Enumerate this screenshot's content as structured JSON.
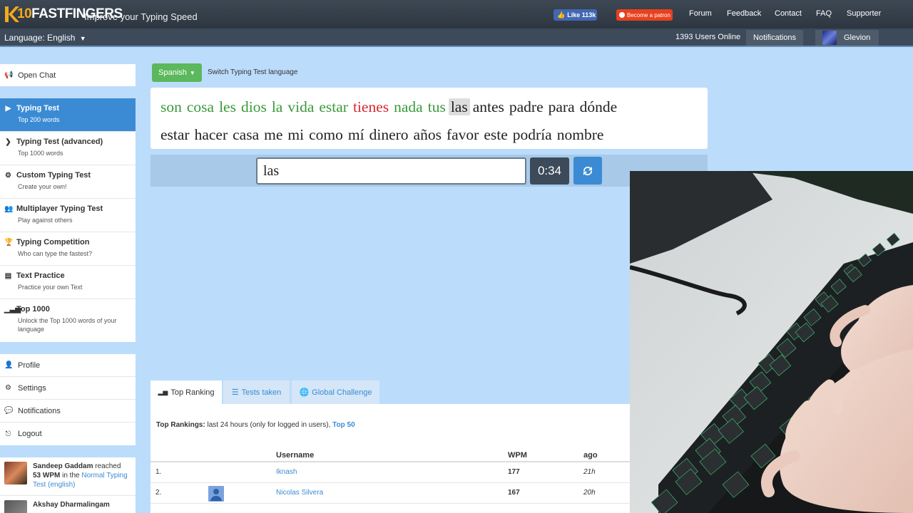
{
  "header": {
    "logo_prefix": "10",
    "logo_text": "FASTFINGERS",
    "tagline": "Improve your Typing Speed",
    "fb_like": "Like 113k",
    "patron": "Become a patron",
    "nav": [
      "Forum",
      "Feedback",
      "Contact",
      "FAQ",
      "Supporter"
    ]
  },
  "subbar": {
    "language": "Language: English",
    "users_online": "1393 Users Online",
    "notifications": "Notifications",
    "username": "Glevion"
  },
  "sidebar": {
    "open_chat": "Open Chat",
    "menu": [
      {
        "title": "Typing Test",
        "sub": "Top 200 words",
        "icon": "play-icon"
      },
      {
        "title": "Typing Test (advanced)",
        "sub": "Top 1000 words",
        "icon": "chevron-right-icon"
      },
      {
        "title": "Custom Typing Test",
        "sub": "Create your own!",
        "icon": "cogs-icon"
      },
      {
        "title": "Multiplayer Typing Test",
        "sub": "Play against others",
        "icon": "users-icon"
      },
      {
        "title": "Typing Competition",
        "sub": "Who can type the fastest?",
        "icon": "trophy-icon"
      },
      {
        "title": "Text Practice",
        "sub": "Practice your own Text",
        "icon": "file-icon"
      },
      {
        "title": "Top 1000",
        "sub": "Unlock the Top 1000 words of your language",
        "icon": "signal-icon"
      }
    ],
    "account": [
      "Profile",
      "Settings",
      "Notifications",
      "Logout"
    ],
    "feed": [
      {
        "name": "Sandeep Gaddam",
        "text1": " reached ",
        "wpm": "53 WPM",
        "text2": " in the ",
        "link": "Normal Typing Test (english)"
      },
      {
        "name": "Akshay Dharmalingam"
      }
    ]
  },
  "typing": {
    "language_button": "Spanish",
    "switch_label": "Switch Typing Test language",
    "line1": [
      {
        "w": "son",
        "s": "ok"
      },
      {
        "w": "cosa",
        "s": "ok"
      },
      {
        "w": "les",
        "s": "ok"
      },
      {
        "w": "dios",
        "s": "ok"
      },
      {
        "w": "la",
        "s": "ok"
      },
      {
        "w": "vida",
        "s": "ok"
      },
      {
        "w": "estar",
        "s": "ok"
      },
      {
        "w": "tienes",
        "s": "bad"
      },
      {
        "w": "nada",
        "s": "ok"
      },
      {
        "w": "tus",
        "s": "ok"
      },
      {
        "w": "las",
        "s": "cur"
      },
      {
        "w": "antes",
        "s": ""
      },
      {
        "w": "padre",
        "s": ""
      },
      {
        "w": "para",
        "s": ""
      },
      {
        "w": "dónde",
        "s": ""
      }
    ],
    "line2": [
      "estar",
      "hacer",
      "casa",
      "me",
      "mi",
      "como",
      "mí",
      "dinero",
      "años",
      "favor",
      "este",
      "podría",
      "nombre"
    ],
    "input_value": "las",
    "timer": "0:34"
  },
  "tabs": [
    "Top Ranking",
    "Tests taken",
    "Global Challenge"
  ],
  "rankings": {
    "title": "Top Rankings:",
    "subtitle": " last 24 hours (only for logged in users), ",
    "link": "Top 50",
    "columns": [
      "Username",
      "WPM",
      "ago"
    ],
    "rows": [
      {
        "rank": "1.",
        "user": "Iknash",
        "wpm": "177",
        "ago": "21h"
      },
      {
        "rank": "2.",
        "user": "Nicolas Silvera",
        "wpm": "167",
        "ago": "20h"
      }
    ]
  },
  "colors": {
    "correct": "#3a9a3a",
    "incorrect": "#d9262c",
    "accent": "#3b8bd4",
    "active_menu": "#3b8bd4",
    "language_button": "#5cb85c"
  }
}
